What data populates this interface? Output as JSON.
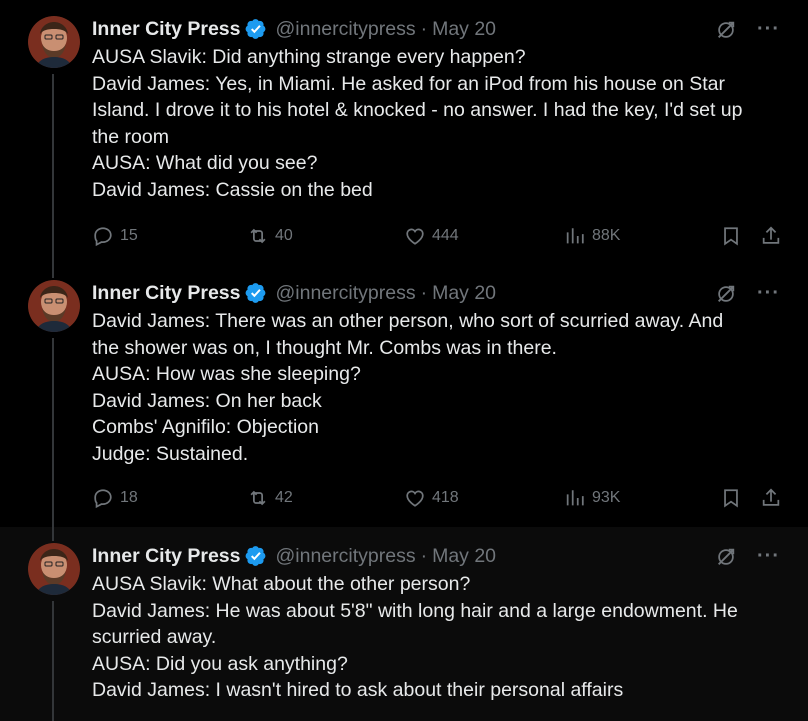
{
  "tweets": [
    {
      "author": {
        "name": "Inner City Press",
        "handle": "@innercitypress",
        "separator": "·",
        "date": "May 20"
      },
      "lines": [
        "AUSA Slavik: Did anything strange every happen?",
        "David James: Yes, in Miami. He asked for an iPod from his house on Star",
        "Island. I drove it to his hotel & knocked - no answer. I had the key, I'd set up",
        "the room",
        "AUSA: What did you see?",
        "David James: Cassie on the bed"
      ],
      "stats": {
        "replies": "15",
        "reposts": "40",
        "likes": "444",
        "views": "88K"
      }
    },
    {
      "author": {
        "name": "Inner City Press",
        "handle": "@innercitypress",
        "separator": "·",
        "date": "May 20"
      },
      "lines": [
        "David James: There was an other person, who sort of scurried away. And",
        "the shower was on, I thought Mr. Combs was in there.",
        "AUSA: How was she sleeping?",
        "David James: On her back",
        "Combs' Agnifilo: Objection",
        "Judge: Sustained."
      ],
      "stats": {
        "replies": "18",
        "reposts": "42",
        "likes": "418",
        "views": "93K"
      }
    },
    {
      "author": {
        "name": "Inner City Press",
        "handle": "@innercitypress",
        "separator": "·",
        "date": "May 20"
      },
      "lines": [
        "AUSA Slavik: What about the other person?",
        "David James: He was about 5'8\" with long hair and a large endowment. He",
        "scurried away.",
        "AUSA: Did you ask anything?",
        "David James: I wasn't hired to ask about their personal affairs"
      ],
      "stats": {}
    }
  ],
  "icons": {
    "more": "···",
    "verified_color": "#1d9bf0",
    "muted_color": "#71767b"
  }
}
